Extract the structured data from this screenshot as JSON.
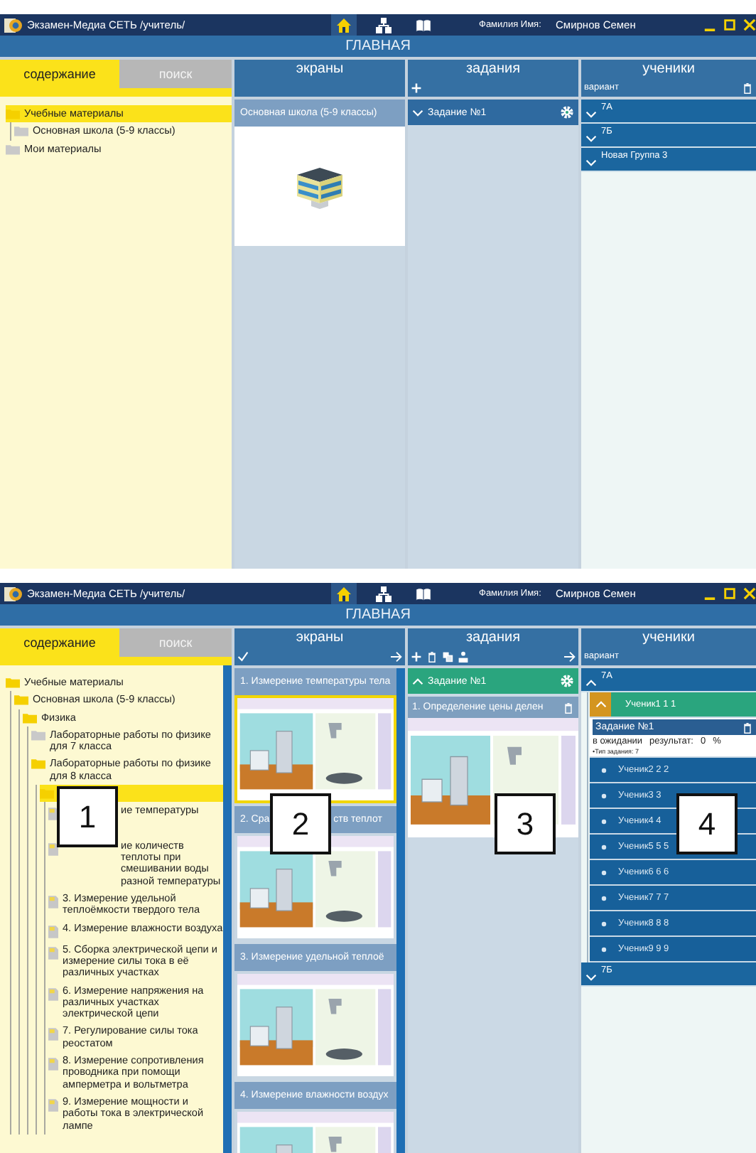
{
  "shots": [
    {
      "title_bar": {
        "app_title": "Экзамен-Медиа СЕТЬ /учитель/",
        "nav": [
          {
            "kind": "home",
            "selected": true
          },
          {
            "kind": "structure",
            "selected": false
          },
          {
            "kind": "book",
            "selected": false
          }
        ],
        "user_label": "Фамилия Имя:",
        "user_name": "Смирнов Семен"
      },
      "page_title": "ГЛАВНАЯ",
      "tabs": [
        {
          "label": "содержание",
          "selected": true
        },
        {
          "label": "поиск",
          "selected": false
        }
      ],
      "tree_panel": {
        "items": [
          {
            "kind": "folder",
            "label": "Учебные материалы",
            "selected": true,
            "expanded": true,
            "children": [
              {
                "kind": "folder",
                "label": "Основная школа (5-9 классы)",
                "selected": false,
                "expanded": false
              }
            ]
          },
          {
            "kind": "folder",
            "label": "Мои материалы",
            "selected": false,
            "expanded": false
          }
        ]
      },
      "screens_column": {
        "title": "экраны",
        "cards": [
          {
            "title_parts": [
              "Основная школа (5-9 классы)"
            ],
            "kind": "building"
          }
        ]
      },
      "tasks_column": {
        "title": "задания",
        "tools_left": [
          {
            "kind": "plus"
          }
        ],
        "tasks": [
          {
            "label": "Задание №1",
            "expanded": false
          }
        ]
      },
      "students_column": {
        "title": "ученики",
        "subtitle": "вариант",
        "tools_right": [
          {
            "kind": "trash"
          }
        ],
        "groups": [
          {
            "label": "7А",
            "expanded": false
          },
          {
            "label": "7Б",
            "expanded": false
          },
          {
            "label": "Новая Группа 3",
            "expanded": false
          }
        ]
      }
    },
    {
      "title_bar": {
        "app_title": "Экзамен-Медиа СЕТЬ /учитель/",
        "nav": [
          {
            "kind": "home",
            "selected": true
          },
          {
            "kind": "structure",
            "selected": false
          },
          {
            "kind": "book",
            "selected": false
          }
        ],
        "user_label": "Фамилия Имя:",
        "user_name": "Смирнов Семен"
      },
      "page_title": "ГЛАВНАЯ",
      "tabs": [
        {
          "label": "содержание",
          "selected": true
        },
        {
          "label": "поиск",
          "selected": false
        }
      ],
      "tree_panel": {
        "scrollbar": true,
        "callout": "1",
        "items": [
          {
            "kind": "folder",
            "label": "Учебные материалы",
            "selected": false,
            "expanded": true,
            "children": [
              {
                "kind": "folder",
                "label": "Основная школа (5-9 классы)",
                "selected": false,
                "expanded": true,
                "children": [
                  {
                    "kind": "folder",
                    "label": "Физика",
                    "selected": false,
                    "expanded": true,
                    "children": [
                      {
                        "kind": "folder",
                        "label": "Лабораторные работы по физике для 7 класса",
                        "selected": false,
                        "expanded": false
                      },
                      {
                        "kind": "folder",
                        "label": "Лабораторные работы по физике для 8 класса",
                        "selected": false,
                        "expanded": true,
                        "children": [
                          {
                            "kind": "folder",
                            "selected": true,
                            "expanded": true,
                            "children": [
                              {
                                "kind": "doc",
                                "label": "ие температуры",
                                "selected": false,
                                "partly_hidden": true
                              },
                              {
                                "kind": "doc",
                                "label": "ие количеств теплоты при смешивании воды разной температуры",
                                "selected": false,
                                "partly_hidden": true
                              },
                              {
                                "kind": "doc",
                                "label": "3. Измерение удельной теплоёмкости твердого тела",
                                "selected": false
                              },
                              {
                                "kind": "doc",
                                "label": "4. Измерение влажности воздуха",
                                "selected": false
                              },
                              {
                                "kind": "doc",
                                "label": "5. Сборка электрической цепи и измерение силы тока в её различных участках",
                                "selected": false
                              },
                              {
                                "kind": "doc",
                                "label": "6. Измерение напряжения на различных участках электрической цепи",
                                "selected": false
                              },
                              {
                                "kind": "doc",
                                "label": "7. Регулирование силы тока реостатом",
                                "selected": false
                              },
                              {
                                "kind": "doc",
                                "label": "8. Измерение сопротивления проводника при помощи амперметра и вольтметра",
                                "selected": false
                              },
                              {
                                "kind": "doc",
                                "label": "9. Измерение мощности и работы тока в электрической лампе",
                                "selected": false
                              }
                            ]
                          }
                        ]
                      }
                    ]
                  }
                ]
              }
            ]
          }
        ]
      },
      "screens_column": {
        "title": "экраны",
        "scrollbar": true,
        "callout": "2",
        "tools_left": [
          {
            "kind": "check"
          }
        ],
        "tools_right": [
          {
            "kind": "arrow"
          }
        ],
        "cards": [
          {
            "title_parts": [
              "1. Измерение температуры тела"
            ],
            "kind": "picture",
            "selected": true
          },
          {
            "title_parts": [
              "2. Сра",
              "ств теплот"
            ],
            "kind": "picture",
            "selected": false
          },
          {
            "title_parts": [
              "3. Измерение удельной теплоё"
            ],
            "kind": "picture",
            "selected": false
          },
          {
            "title_parts": [
              "4. Измерение влажности воздух"
            ],
            "kind": "picture",
            "selected": false
          }
        ]
      },
      "tasks_column": {
        "title": "задания",
        "callout": "3",
        "tools_left": [
          {
            "kind": "plus"
          },
          {
            "kind": "trash"
          },
          {
            "kind": "copy"
          },
          {
            "kind": "people"
          }
        ],
        "tools_right": [
          {
            "kind": "arrow"
          }
        ],
        "tasks": [
          {
            "label": "Задание №1",
            "expanded": true,
            "items": [
              {
                "title": "1. Определение цены делен",
                "kind": "picture"
              }
            ]
          }
        ]
      },
      "students_column": {
        "title": "ученики",
        "subtitle": "вариант",
        "callout": "4",
        "groups": [
          {
            "label": "7А",
            "expanded": true,
            "students": [
              {
                "name": "Ученик1 1 1",
                "expanded": true,
                "task": {
                  "title": "Задание №1",
                  "status": "в ожидании",
                  "result_label": "результат:",
                  "result": "0",
                  "unit": "%",
                  "type": "•Тип задания: 7"
                }
              },
              {
                "name": "Ученик2 2 2",
                "expanded": false
              },
              {
                "name": "Ученик3 3",
                "expanded": false
              },
              {
                "name": "Ученик4 4",
                "expanded": false
              },
              {
                "name": "Ученик5 5 5",
                "expanded": false
              },
              {
                "name": "Ученик6 6 6",
                "expanded": false
              },
              {
                "name": "Ученик7 7 7",
                "expanded": false
              },
              {
                "name": "Ученик8 8 8",
                "expanded": false
              },
              {
                "name": "Ученик9 9 9",
                "expanded": false
              }
            ]
          },
          {
            "label": "7Б",
            "expanded": false
          }
        ]
      }
    }
  ]
}
